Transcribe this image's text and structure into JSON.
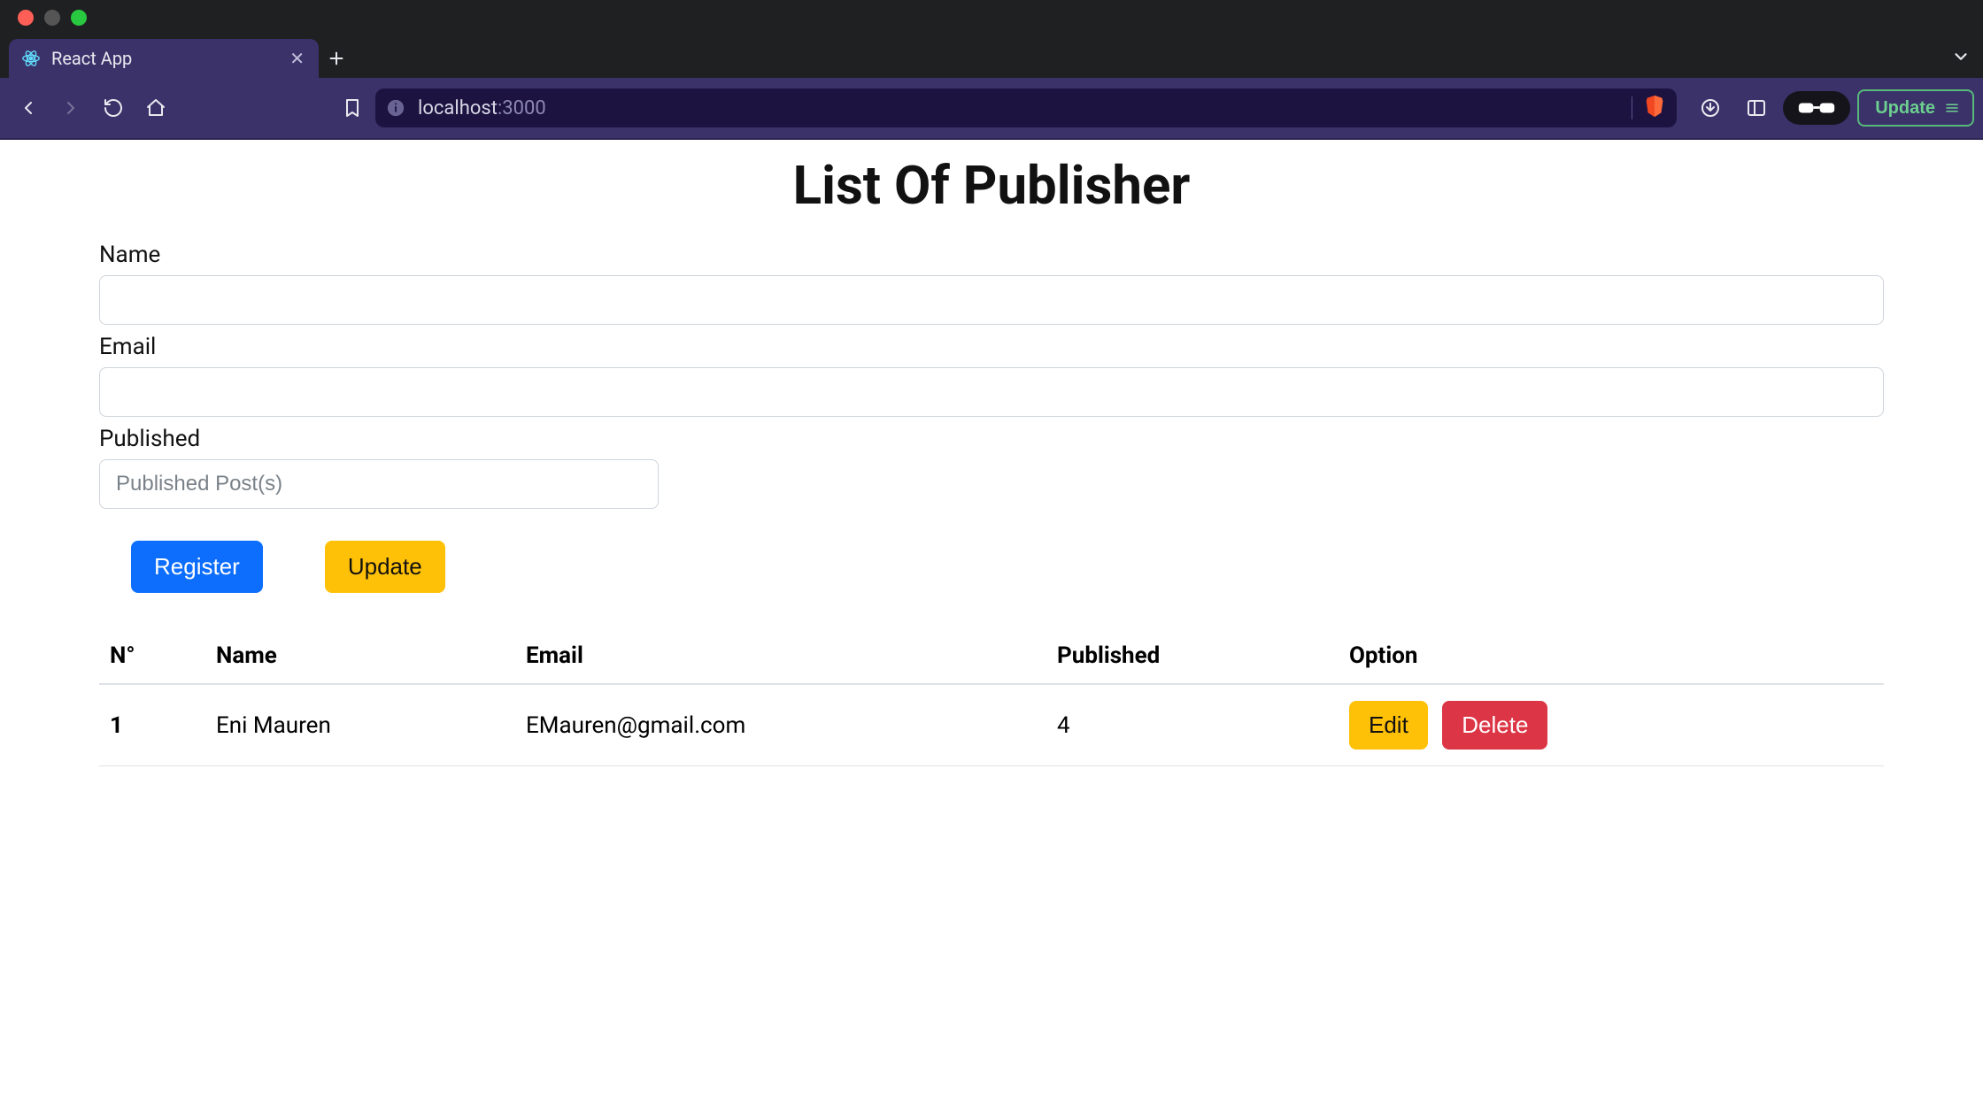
{
  "browser": {
    "tab_title": "React App",
    "url_host": "localhost",
    "url_port": ":3000",
    "update_label": "Update"
  },
  "page": {
    "title": "List Of Publisher",
    "labels": {
      "name": "Name",
      "email": "Email",
      "published": "Published"
    },
    "placeholders": {
      "published": "Published Post(s)"
    },
    "buttons": {
      "register": "Register",
      "update": "Update",
      "edit": "Edit",
      "delete": "Delete"
    },
    "table": {
      "headers": {
        "num": "N°",
        "name": "Name",
        "email": "Email",
        "published": "Published",
        "option": "Option"
      },
      "rows": [
        {
          "num": "1",
          "name": "Eni Mauren",
          "email": "EMauren@gmail.com",
          "published": "4"
        }
      ]
    }
  }
}
